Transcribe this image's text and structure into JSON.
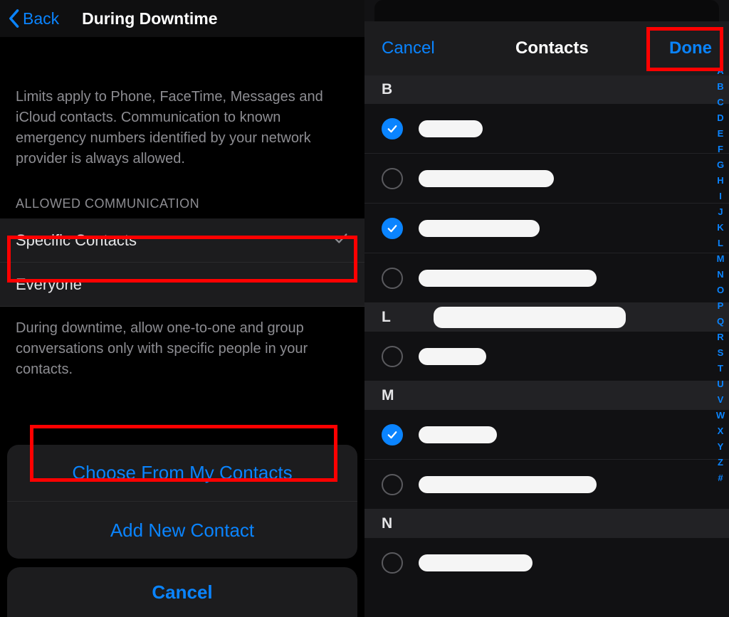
{
  "left": {
    "back_label": "Back",
    "title": "During Downtime",
    "description": "Limits apply to Phone, FaceTime, Messages and iCloud contacts. Communication to known emergency numbers identified by your network provider is always allowed.",
    "section_header": "ALLOWED COMMUNICATION",
    "option_specific": "Specific Contacts",
    "option_everyone": "Everyone",
    "footer": "During downtime, allow one-to-one and group conversations only with specific people in your contacts.",
    "sheet_choose": "Choose From My Contacts",
    "sheet_add": "Add New Contact",
    "sheet_cancel": "Cancel"
  },
  "right": {
    "cancel_label": "Cancel",
    "title": "Contacts",
    "done_label": "Done",
    "sections": [
      {
        "letter": "B",
        "rows": [
          {
            "checked": true,
            "redact_w": 90
          },
          {
            "checked": false,
            "redact_w": 190
          },
          {
            "checked": true,
            "redact_w": 170
          },
          {
            "checked": false,
            "redact_w": 250
          }
        ]
      },
      {
        "letter": "L",
        "rows": [
          {
            "checked": false,
            "redact_w": 95
          }
        ]
      },
      {
        "letter": "M",
        "rows": [
          {
            "checked": true,
            "redact_w": 110
          },
          {
            "checked": false,
            "redact_w": 250
          }
        ]
      },
      {
        "letter": "N",
        "rows": [
          {
            "checked": false,
            "redact_w": 160
          }
        ]
      }
    ],
    "index": [
      "A",
      "B",
      "C",
      "D",
      "E",
      "F",
      "G",
      "H",
      "I",
      "J",
      "K",
      "L",
      "M",
      "N",
      "O",
      "P",
      "Q",
      "R",
      "S",
      "T",
      "U",
      "V",
      "W",
      "X",
      "Y",
      "Z",
      "#"
    ]
  }
}
